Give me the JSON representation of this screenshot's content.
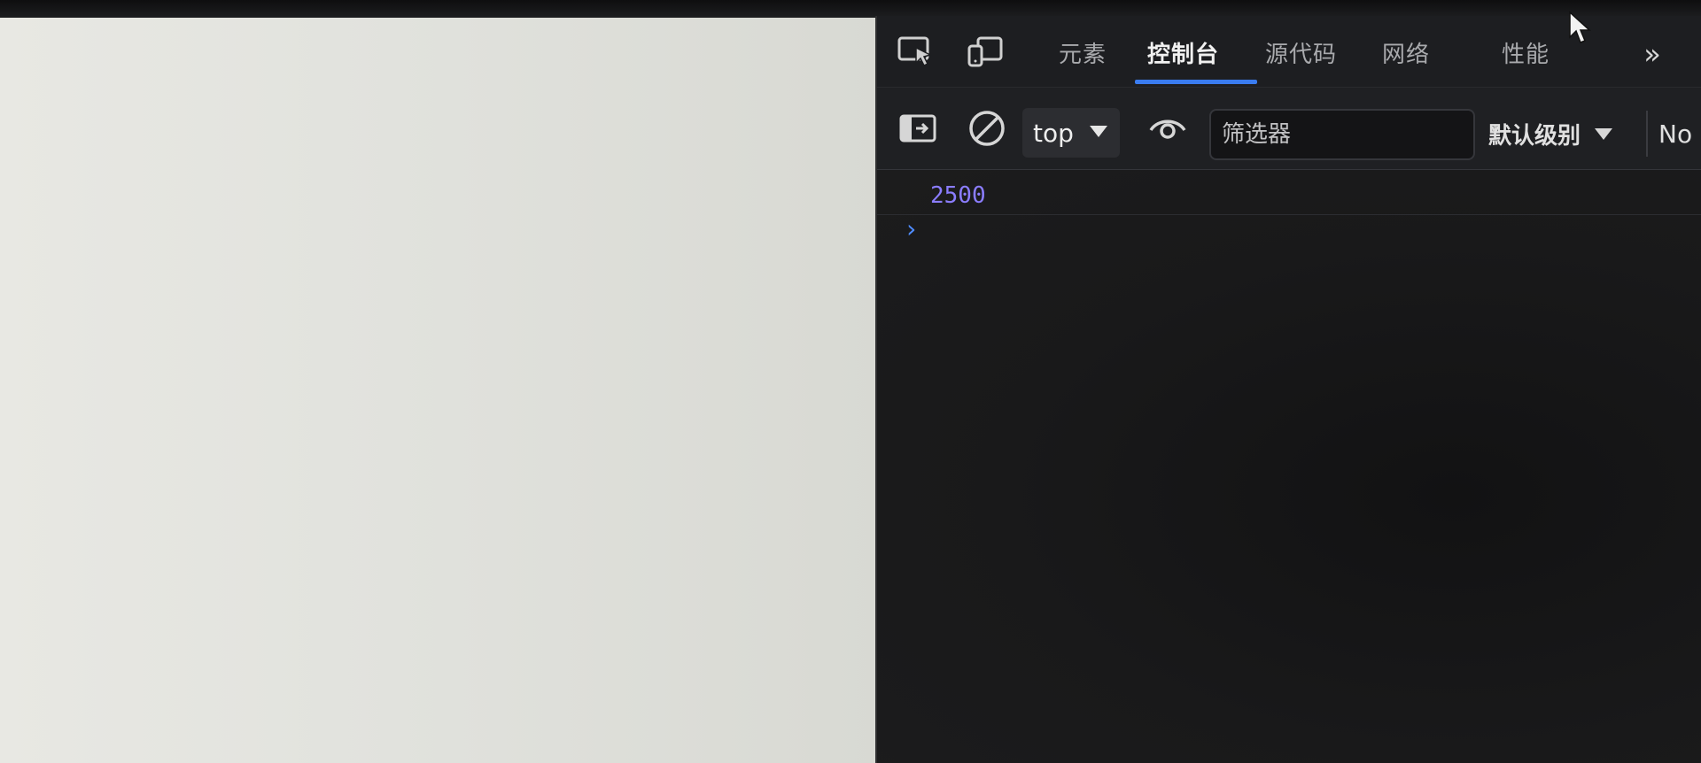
{
  "devtools": {
    "tabs": [
      {
        "label": "元素",
        "active": false
      },
      {
        "label": "控制台",
        "active": true
      },
      {
        "label": "源代码",
        "active": false
      },
      {
        "label": "网络",
        "active": false
      },
      {
        "label": "性能",
        "active": false
      }
    ],
    "more_tabs_glyph": "»",
    "icons": {
      "inspect": "inspect-element-icon",
      "device": "device-toolbar-icon",
      "sidebar": "show-sidebar-icon",
      "clear": "clear-console-icon",
      "eye": "live-expression-icon",
      "more": "more-tabs-icon"
    }
  },
  "toolbar": {
    "context": "top",
    "filter_placeholder": "筛选器",
    "levels_label": "默认级别",
    "issues_label": "No"
  },
  "console": {
    "entries": [
      {
        "value": "2500"
      }
    ],
    "prompt_glyph": "›"
  },
  "colors": {
    "accent": "#3a7cf0",
    "number": "#8b7dff",
    "page_background": "#e3e4df",
    "devtools_background": "#1a1a1b"
  }
}
